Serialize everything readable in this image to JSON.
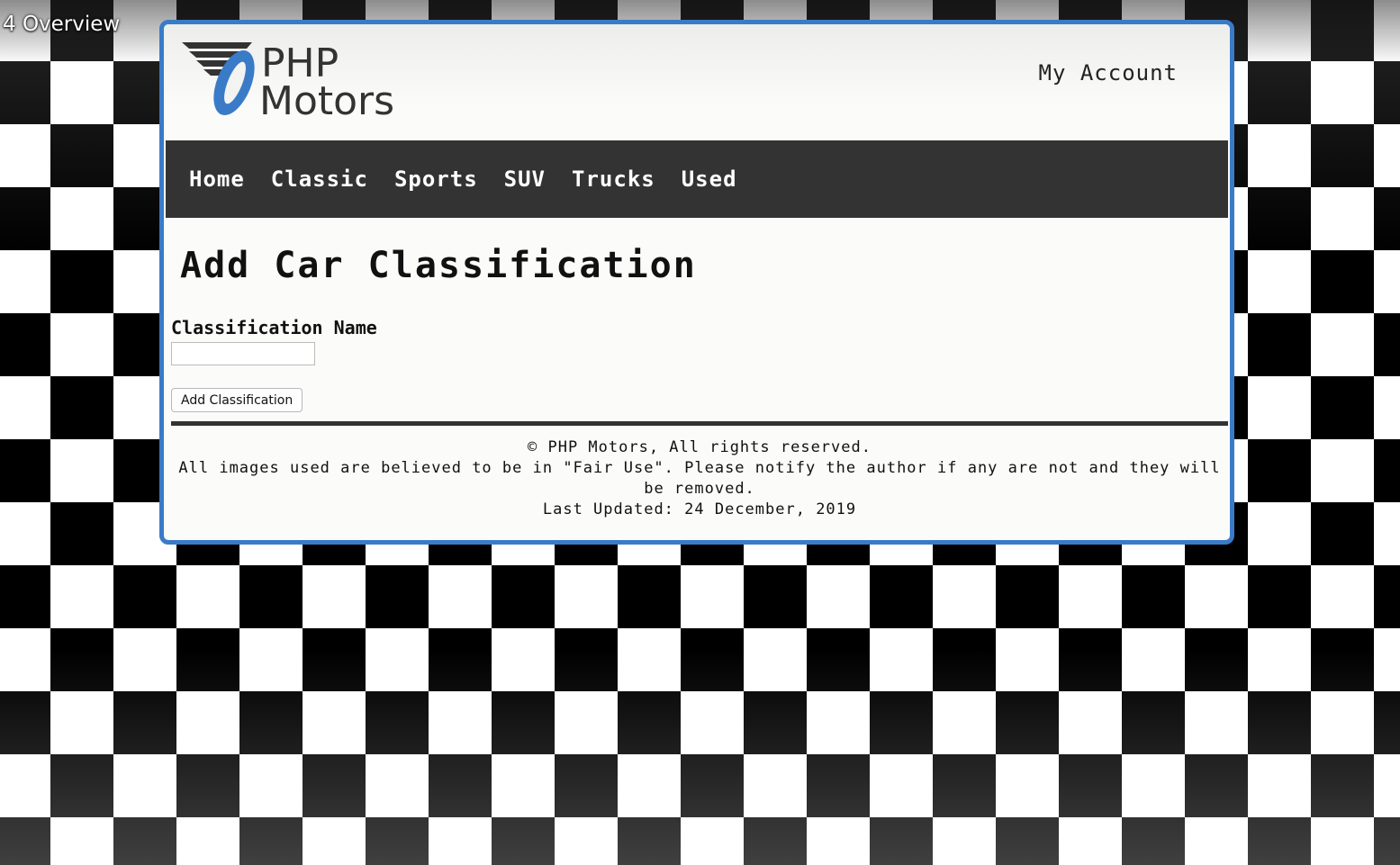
{
  "video": {
    "title": "4 Overview"
  },
  "header": {
    "logo_text": "PHP Motors",
    "logo_line1": "PHP",
    "logo_line2": "Motors",
    "account_label": "My Account"
  },
  "nav": {
    "items": [
      {
        "label": "Home"
      },
      {
        "label": "Classic"
      },
      {
        "label": "Sports"
      },
      {
        "label": "SUV"
      },
      {
        "label": "Trucks"
      },
      {
        "label": "Used"
      }
    ]
  },
  "main": {
    "title": "Add Car Classification",
    "field_label": "Classification Name",
    "field_value": "",
    "submit_label": "Add Classification"
  },
  "footer": {
    "copyright": "© PHP Motors, All rights reserved.",
    "notice": "All images used are believed to be in \"Fair Use\". Please notify the author if any are not and they will be removed.",
    "last_updated": "Last Updated: 24 December, 2019"
  },
  "colors": {
    "frame_border": "#3a7bc8",
    "nav_bg": "#333333",
    "logo_accent": "#3a7bc8"
  }
}
